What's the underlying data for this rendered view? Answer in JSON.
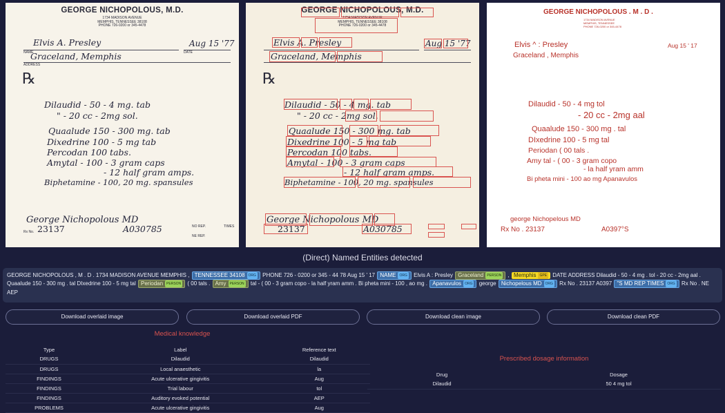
{
  "panel_original": {
    "header": "GEORGE NICHOPOLOUS, M.D.",
    "address_lines": [
      "1734 MADISON AVENUE",
      "MEMPHIS, TENNESSEE 38108",
      "PHONE 726-0200 or 345-4478"
    ],
    "name_label": "NAME",
    "date_label": "DATE",
    "address_label": "ADDRESS",
    "patient": "Elvis A. Presley",
    "date": "Aug 15 '77",
    "address": "Graceland, Memphis",
    "rx_symbol": "℞",
    "lines": [
      "Dilaudid - 50 - 4 mg. tab",
      "\"        - 20 cc - 2mg sol.",
      "Quaalude 150 - 300 mg. tab",
      "Dixedrine 100 - 5 mg tab",
      "Percodan 100 tabs.",
      "Amytal - 100 - 3 gram caps",
      "- 12 half gram amps.",
      "Biphetamine - 100, 20 mg. spansules"
    ],
    "signature": "George Nichopolous MD",
    "rx_no_label": "Rx No.",
    "rx_no": "23137",
    "license": "A030785",
    "no_rep": "NO REP.",
    "times": "TIMES",
    "ne_rep": "NE REP."
  },
  "panel_clean": {
    "header": "GEORGE      NICHOPOLOUS      . M . D .",
    "addr": [
      "1734 MADISON AVENUE",
      "MEMPHIS, TENNESSEE",
      "PHONE 726-0200 or 345-4478"
    ],
    "patient": "Elvis       ^ : Presley",
    "date": "Aug  15 ' 17",
    "address": "Graceland ,     Memphis",
    "lines": [
      {
        "text": "Dilaudid   -  50  -   4      mg    tol",
        "size": 11
      },
      {
        "text": "- 20 cc - 2mg     aal",
        "size": 13
      },
      {
        "text": "Quaalude    150  -   300    mg . tal",
        "size": 11
      },
      {
        "text": "DIxedrine    100   -   5    mg    tal",
        "size": 11
      },
      {
        "text": "Periodan     (  00     tals  .",
        "size": 10
      },
      {
        "text": "Amy  tal    -  ( 00 - 3   gram  copo",
        "size": 10
      },
      {
        "text": "-  la     half   yram  amm",
        "size": 10
      },
      {
        "text": "Bi pheta   mini  -  100    ao    mg     Apanavulos",
        "size": 9
      }
    ],
    "signature": "george         Nichopelous          MD",
    "rx_no": "Rx No . 23137",
    "license": "A0397°S"
  },
  "section_title": "(Direct) Named Entities detected",
  "entities_html_parts": {
    "t1": "GEORGE NICHOPOLOUS , M . D . 1734 MADISON AVENUE MEMPHIS ,",
    "e1": "TENNESSEE 34108",
    "e1tag": "ORG",
    "t2": "PHONE 726 - 0200 or 345 - 44 78 Aug 15 ' 17",
    "e2": "NAME",
    "e2tag": "ORG",
    "t3": "Elvis A : Presley",
    "e3": "Graceland",
    "e3tag": "PERSON",
    "t4": ",",
    "e4": "Memphis",
    "e4tag": "GPE",
    "t5": "DATE ADDRESS",
    "t6": "Dilaudid - 50 - 4 mg . tol - 20 cc - 2mg aal . Quaalude 150 - 300 mg . tal DIxedrine 100 - 5 mg tal",
    "e5": "Periodan",
    "e5tag": "PERSON",
    "t7": "( 00 tals .",
    "e6": "Amy",
    "e6tag": "PERSON",
    "t8": "tal - ( 00 - 3 gram copo - la half yram amm . Bi pheta mini - 100 , ao mg .",
    "e7": "Apanavulos",
    "e7tag": "ORG",
    "t9": "george",
    "e8": "Nichopelous MD",
    "e8tag": "ORG",
    "t10": "Rx No . 23137 A0397",
    "e9": "\"S MD REP TIMES",
    "e9tag": "ORG",
    "t11": "Rx No . NE AEP"
  },
  "buttons": {
    "b1": "Download overlaid image",
    "b2": "Download overlaid PDF",
    "b3": "Download clean image",
    "b4": "Download clean PDF"
  },
  "medical": {
    "title": "Medical knowledge",
    "headers": [
      "Type",
      "Label",
      "Reference text"
    ],
    "rows": [
      [
        "DRUGS",
        "Dilaudid",
        "Dilaudid"
      ],
      [
        "DRUGS",
        "Local anaesthetic",
        "la"
      ],
      [
        "FINDINGS",
        "Acute ulcerative gingivitis",
        "Aug"
      ],
      [
        "FINDINGS",
        "Trial labour",
        "tol"
      ],
      [
        "FINDINGS",
        "Auditory evoked potential",
        "AEP"
      ],
      [
        "PROBLEMS",
        "Acute ulcerative gingivitis",
        "Aug"
      ]
    ]
  },
  "dosage": {
    "title": "Prescribed dosage information",
    "headers": [
      "Drug",
      "Dosage"
    ],
    "rows": [
      [
        "Dilaudid",
        "50 4 mg tol"
      ]
    ]
  },
  "colors": {
    "background": "#1b1d3a",
    "accent_red": "#d9534f",
    "entity_org": "#3d6ea8",
    "entity_person": "#68704a",
    "entity_gpe": "#f5d924"
  }
}
